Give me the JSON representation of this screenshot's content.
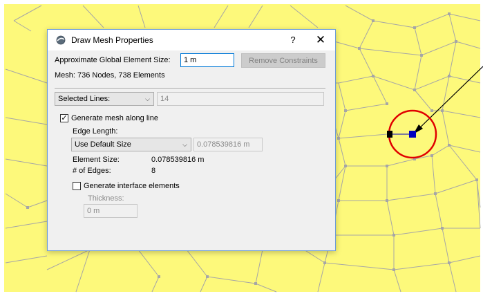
{
  "dialog": {
    "title": "Draw Mesh Properties",
    "help_label": "?",
    "close_label": "✕",
    "global_size_label": "Approximate Global Element Size:",
    "global_size_value": "1 m",
    "remove_constraints_label": "Remove Constraints",
    "mesh_info": "Mesh:  736 Nodes, 738 Elements",
    "selection_dropdown": "Selected Lines:",
    "selection_count": "14",
    "generate_mesh_label": "Generate mesh along line",
    "generate_mesh_checked": "✓",
    "edge_length_label": "Edge Length:",
    "edge_length_dropdown": "Use Default Size",
    "edge_length_value": "0.078539816 m",
    "element_size_label": "Element Size:",
    "element_size_value": "0.078539816 m",
    "num_edges_label": "# of Edges:",
    "num_edges_value": "8",
    "interface_label": "Generate interface elements",
    "thickness_label": "Thickness:",
    "thickness_value": "0 m",
    "dropdown_chevron": "⌵"
  },
  "canvas": {
    "background_color": "#fdf97b",
    "line_color": "#a6a6a6",
    "node_color": "#a6a6a6",
    "selection_circle_color": "#e00000",
    "selected_node_color": "#0000c0",
    "endpoint_color": "#000000",
    "arrow_color": "#000000"
  }
}
